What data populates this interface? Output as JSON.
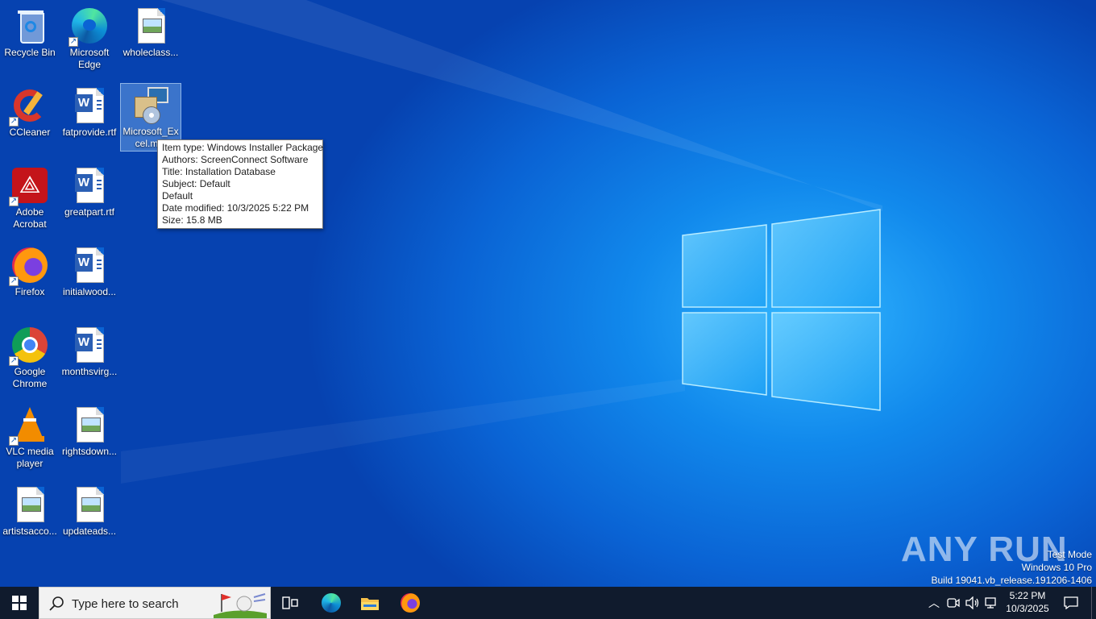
{
  "desktop_icons": [
    {
      "label": "Recycle Bin",
      "icon": "recycle-bin-icon"
    },
    {
      "label": "Microsoft Edge",
      "icon": "edge-icon"
    },
    {
      "label": "wholeclass...",
      "icon": "image-file-icon"
    },
    {
      "label": "CCleaner",
      "icon": "ccleaner-icon"
    },
    {
      "label": "fatprovide.rtf",
      "icon": "word-document-icon"
    },
    {
      "label": "Microsoft_Excel.m...",
      "icon": "installer-package-icon"
    },
    {
      "label": "Adobe Acrobat",
      "icon": "acrobat-icon"
    },
    {
      "label": "greatpart.rtf",
      "icon": "word-document-icon"
    },
    {
      "label": "Firefox",
      "icon": "firefox-icon"
    },
    {
      "label": "initialwood...",
      "icon": "word-document-icon"
    },
    {
      "label": "Google Chrome",
      "icon": "chrome-icon"
    },
    {
      "label": "monthsvirg...",
      "icon": "word-document-icon"
    },
    {
      "label": "VLC media player",
      "icon": "vlc-icon"
    },
    {
      "label": "rightsdown...",
      "icon": "image-file-icon"
    },
    {
      "label": "artistsacco...",
      "icon": "image-file-icon"
    },
    {
      "label": "updateads...",
      "icon": "image-file-icon"
    }
  ],
  "tooltip": {
    "lines": [
      "Item type: Windows Installer Package",
      "Authors: ScreenConnect Software",
      "Title: Installation Database",
      "Subject: Default",
      "Default",
      "Date modified: 10/3/2025 5:22 PM",
      "Size: 15.8 MB"
    ]
  },
  "watermark": {
    "line1": "Test Mode",
    "line2": "Windows 10 Pro",
    "line3": "Build 19041.vb_release.191206-1406",
    "brand": "ANY RUN"
  },
  "taskbar": {
    "search_placeholder": "Type here to search",
    "pinned": [
      "task-view-icon",
      "edge-icon",
      "file-explorer-icon",
      "firefox-icon"
    ]
  },
  "clock": {
    "time": "5:22 PM",
    "date": "10/3/2025"
  },
  "colors": {
    "taskbar": "#101b2d",
    "desktop": "#0a63d4",
    "accent": "#1189ec"
  }
}
